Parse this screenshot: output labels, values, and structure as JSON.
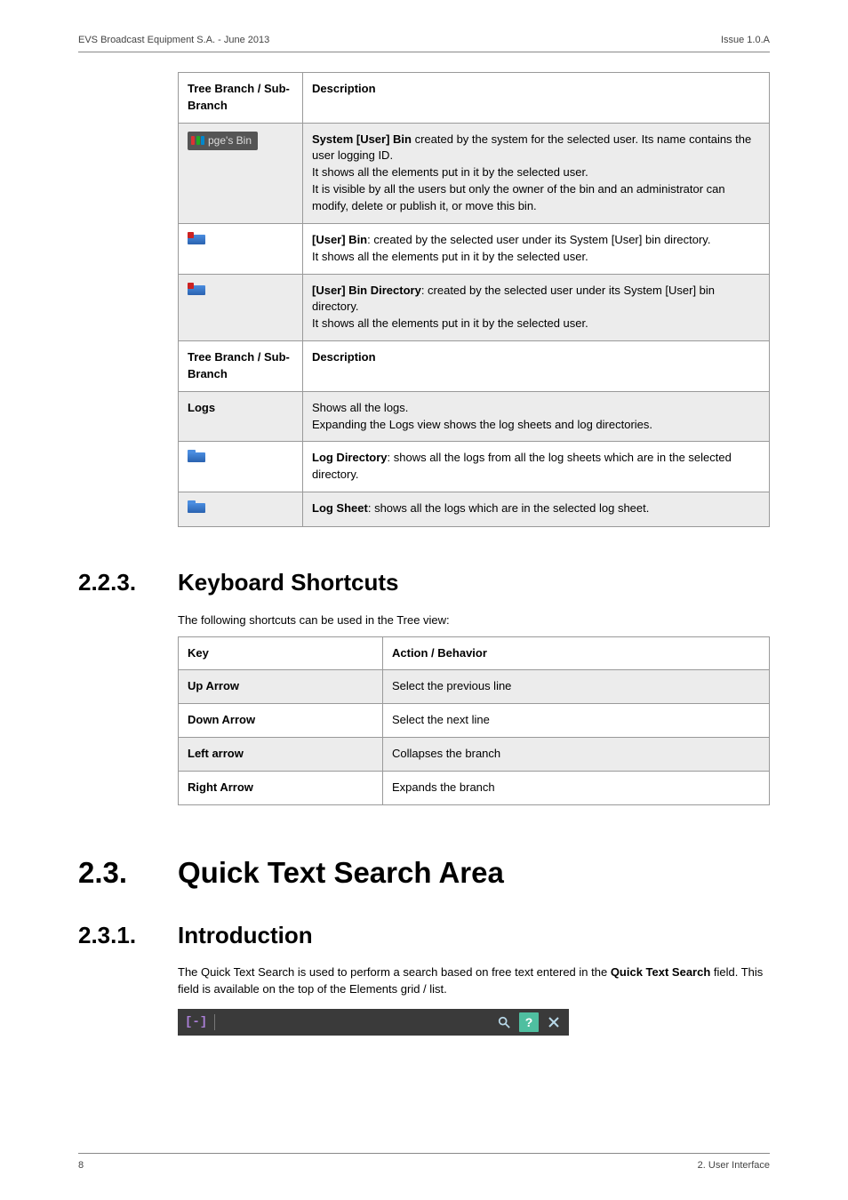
{
  "header": {
    "left": "EVS Broadcast Equipment S.A. - June 2013",
    "right": "Issue 1.0.A"
  },
  "table1": {
    "head": {
      "c1": "Tree Branch / Sub-Branch",
      "c2": "Description"
    },
    "rows": [
      {
        "c1_badge": "pge's Bin",
        "c2_strong": "System [User] Bin",
        "c2_rest": " created by the system for the selected user. Its name contains the user logging ID.\nIt shows all the elements put in it by the selected user.\nIt is visible by all the users but only the owner of the bin and an administrator can modify, delete or publish it, or move this bin."
      },
      {
        "icon": "folder-red",
        "c2_strong": "[User] Bin",
        "c2_rest": ": created by the selected user under its System [User] bin directory.\nIt shows all the elements put in it by the selected user."
      },
      {
        "icon": "folder-red",
        "c2_strong": "[User] Bin Directory",
        "c2_rest": ": created by the selected user under its System [User] bin directory.\nIt shows all the elements put in it by the selected user."
      }
    ]
  },
  "table2": {
    "head": {
      "c1": "Tree Branch / Sub-Branch",
      "c2": "Description"
    },
    "rows": [
      {
        "c1_text": "Logs",
        "c2_plain": "Shows all the logs.\nExpanding the Logs view shows the log sheets and log directories."
      },
      {
        "icon": "folder-blue",
        "c2_strong": "Log Directory",
        "c2_rest": ": shows all the logs from all the log sheets which are in the selected directory."
      },
      {
        "icon": "folder-blue",
        "c2_strong": "Log Sheet",
        "c2_rest": ": shows all the logs which are in the selected log sheet."
      }
    ]
  },
  "sec223": {
    "num": "2.2.3.",
    "title": "Keyboard Shortcuts",
    "intro": "The following shortcuts can be used in the Tree view:",
    "head": {
      "c1": "Key",
      "c2": "Action / Behavior"
    },
    "rows": [
      {
        "k": "Up Arrow",
        "v": "Select the previous line"
      },
      {
        "k": "Down Arrow",
        "v": "Select the next line"
      },
      {
        "k": "Left arrow",
        "v": "Collapses the branch"
      },
      {
        "k": "Right Arrow",
        "v": "Expands the branch"
      }
    ]
  },
  "sec23": {
    "num": "2.3.",
    "title": "Quick Text Search Area"
  },
  "sec231": {
    "num": "2.3.1.",
    "title": "Introduction",
    "p1_a": "The Quick Text Search is used to perform a search based on free text entered in the ",
    "p1_b": "Quick Text Search",
    "p1_c": " field. This field is available on the top of the Elements grid / list."
  },
  "searchbar": {
    "bracket": "[-]"
  },
  "footer": {
    "left": "8",
    "right": "2. User Interface"
  }
}
